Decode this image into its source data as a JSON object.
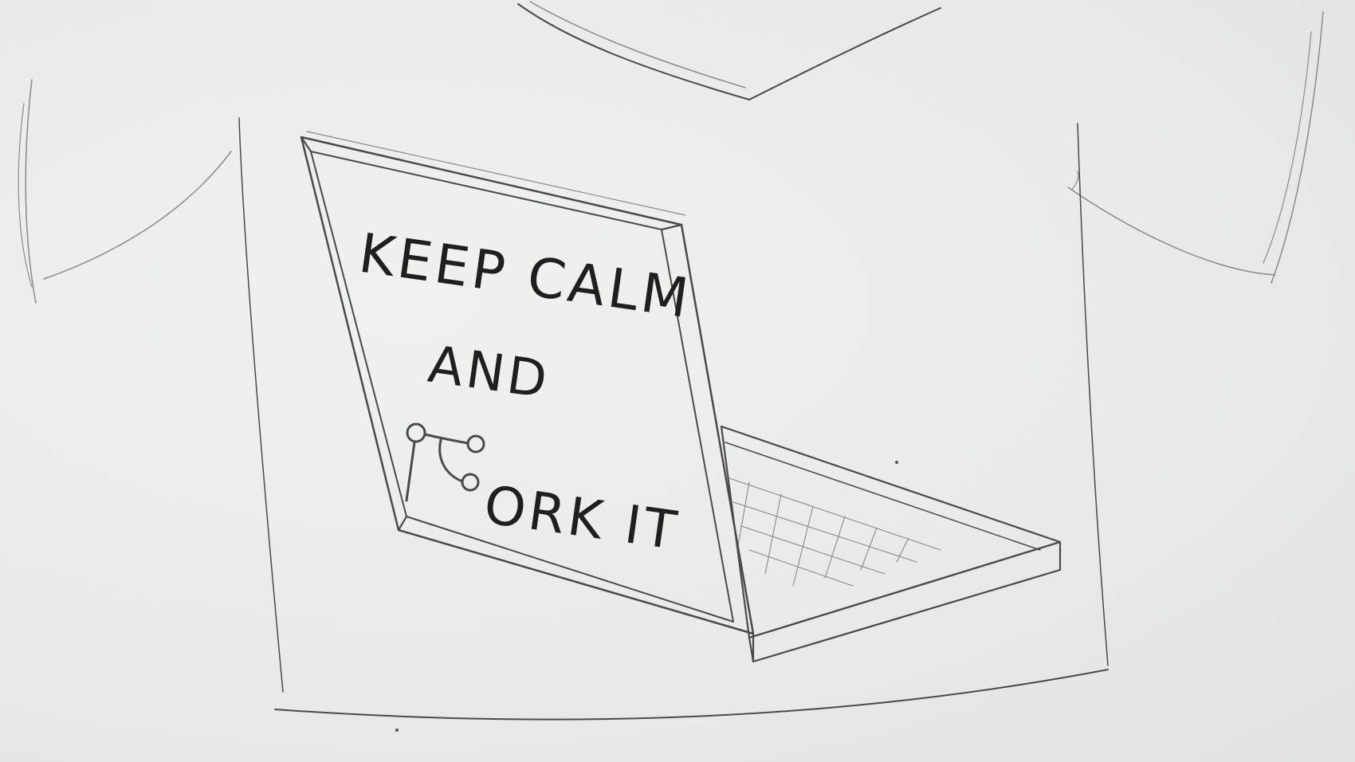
{
  "drawing": {
    "subject": "pencil sketch of a t-shirt with a laptop graphic",
    "screen_text": {
      "line1": "KEEP CALM",
      "line2": "AND",
      "line3": "ORK IT"
    },
    "icon": "git-fork-icon",
    "colors": {
      "paper": "#ecedea",
      "pencil": "#4a4a4a",
      "ink": "#1f1f1f"
    }
  }
}
